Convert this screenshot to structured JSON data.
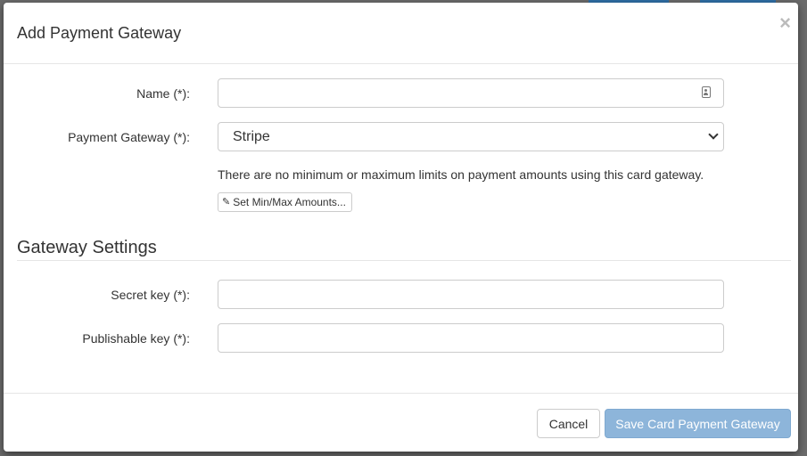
{
  "modal": {
    "title": "Add Payment Gateway",
    "close_symbol": "×"
  },
  "form": {
    "name": {
      "label": "Name (*):",
      "value": "",
      "placeholder": "",
      "icon": "contact-card-icon"
    },
    "gateway": {
      "label": "Payment Gateway (*):",
      "selected": "Stripe"
    },
    "limits_help": "There are no minimum or maximum limits on payment amounts using this card gateway.",
    "set_limits_button": {
      "icon": "pencil-icon",
      "label": "Set Min/Max Amounts..."
    }
  },
  "gateway_settings": {
    "title": "Gateway Settings",
    "secret_key": {
      "label": "Secret key (*):",
      "value": ""
    },
    "publishable_key": {
      "label": "Publishable key (*):",
      "value": ""
    }
  },
  "footer": {
    "cancel_label": "Cancel",
    "save_label": "Save Card Payment Gateway"
  },
  "colors": {
    "primary_disabled": "#8db5da",
    "border": "#cccccc"
  }
}
